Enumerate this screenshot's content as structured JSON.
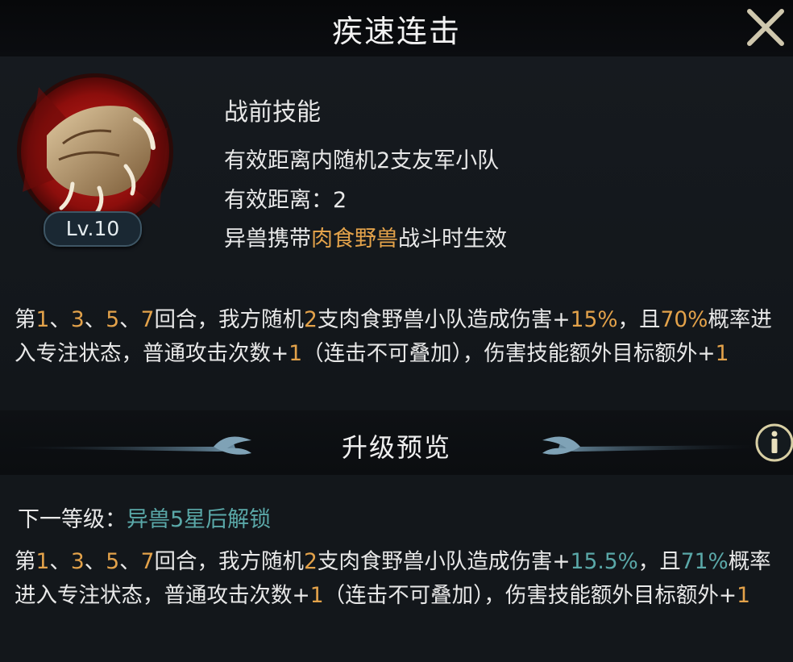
{
  "header": {
    "title": "疾速连击"
  },
  "skill": {
    "level": "Lv.10",
    "type": "战前技能",
    "target": "有效距离内随机2支友军小队",
    "range_label": "有效距离：",
    "range_value": "2",
    "cond_prefix": "异兽携带",
    "cond_highlight": "肉食野兽",
    "cond_suffix": "战斗时生效"
  },
  "current_desc": {
    "p1": "第",
    "n1": "1",
    "s1": "、",
    "n2": "3",
    "s2": "、",
    "n3": "5",
    "s3": "、",
    "n4": "7",
    "p2": "回合，我方随机",
    "n5": "2",
    "p3": "支肉食野兽小队造成伤害+",
    "n6": "15%",
    "p4": "，且",
    "n7": "70%",
    "p5": "概率进入专注状态，普通攻击次数+",
    "n8": "1",
    "p6": "（连击不可叠加），伤害技能额外目标额外+",
    "n9": "1"
  },
  "upgrade_preview": {
    "title": "升级预览",
    "next_label": "下一等级：",
    "next_value": "异兽5星后解锁"
  },
  "next_desc": {
    "p1": "第",
    "n1": "1",
    "s1": "、",
    "n2": "3",
    "s2": "、",
    "n3": "5",
    "s3": "、",
    "n4": "7",
    "p2": "回合，我方随机",
    "n5": "2",
    "p3": "支肉食野兽小队造成伤害+",
    "n6": "15.5%",
    "p4": "，且",
    "n7": "71%",
    "p5": "概率进入专注状态，普通攻击次数+",
    "n8": "1",
    "p6": "（连击不可叠加），伤害技能额外目标额外+",
    "n9": "1"
  },
  "icons": {
    "close": "close-icon",
    "info": "info-icon",
    "skill": "beast-claw-icon"
  },
  "colors": {
    "highlight_gold": "#e3a24a",
    "highlight_teal": "#5aa8a8"
  }
}
